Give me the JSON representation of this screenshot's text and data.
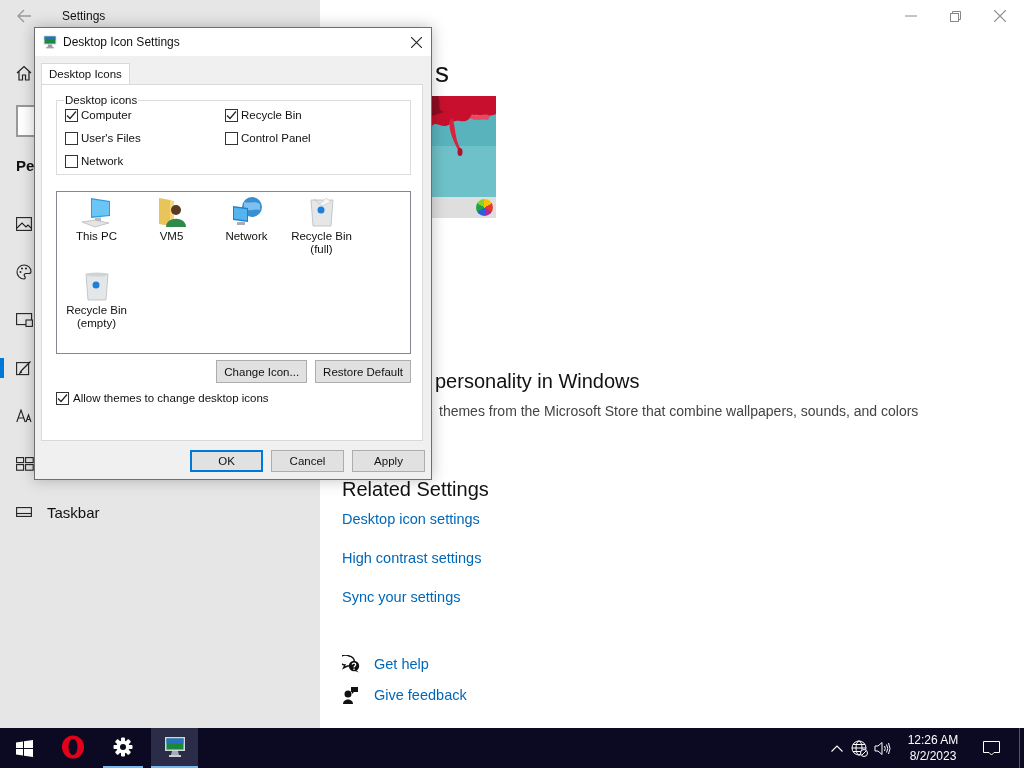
{
  "settings": {
    "title": "Settings",
    "sidebar": {
      "heading": "Pe",
      "items": [
        {
          "kind": "picture",
          "selected": false
        },
        {
          "kind": "palette",
          "selected": false
        },
        {
          "kind": "lockscreen",
          "selected": false
        },
        {
          "kind": "brush",
          "selected": true
        },
        {
          "kind": "font",
          "selected": false
        },
        {
          "kind": "start",
          "selected": false
        },
        {
          "kind": "taskbar",
          "label": "Taskbar",
          "selected": false
        }
      ]
    },
    "content": {
      "heading_fragment": "s",
      "theme_preview": {
        "kind": "picture"
      },
      "store_heading": "personality in Windows",
      "store_text": "themes from the Microsoft Store that combine wallpapers, sounds, and colors",
      "related_heading": "Related Settings",
      "related_links": [
        "Desktop icon settings",
        "High contrast settings",
        "Sync your settings"
      ],
      "help_links": [
        {
          "kind": "help",
          "label": "Get help"
        },
        {
          "kind": "feedback",
          "label": "Give feedback"
        }
      ]
    }
  },
  "dialog": {
    "title": "Desktop Icon Settings",
    "tabs": [
      {
        "label": "Desktop Icons",
        "selected": true
      }
    ],
    "group_label": "Desktop icons",
    "checkboxes": [
      {
        "label": "Computer",
        "checked": true
      },
      {
        "label": "Recycle Bin",
        "checked": true
      },
      {
        "label": "User's Files",
        "checked": false
      },
      {
        "label": "Control Panel",
        "checked": false
      },
      {
        "label": "Network",
        "checked": false
      }
    ],
    "icons": [
      {
        "kind": "pc",
        "label": "This PC"
      },
      {
        "kind": "user",
        "label": "VM5"
      },
      {
        "kind": "network",
        "label": "Network"
      },
      {
        "kind": "bin-full",
        "label": "Recycle Bin (full)"
      },
      {
        "kind": "bin-empty",
        "label": "Recycle Bin (empty)"
      }
    ],
    "icon_buttons": [
      "Change Icon...",
      "Restore Default"
    ],
    "allow_themes": {
      "label": "Allow themes to change desktop icons",
      "checked": true
    },
    "buttons": [
      {
        "label": "OK",
        "default": true
      },
      {
        "label": "Cancel",
        "default": false
      },
      {
        "label": "Apply",
        "default": false
      }
    ]
  },
  "taskbar": {
    "apps": [
      {
        "kind": "opera",
        "running": false,
        "active": false
      },
      {
        "kind": "settings",
        "running": true,
        "active": false
      },
      {
        "kind": "display",
        "running": true,
        "active": true
      }
    ],
    "time": "12:26 AM",
    "date": "8/2/2023"
  }
}
